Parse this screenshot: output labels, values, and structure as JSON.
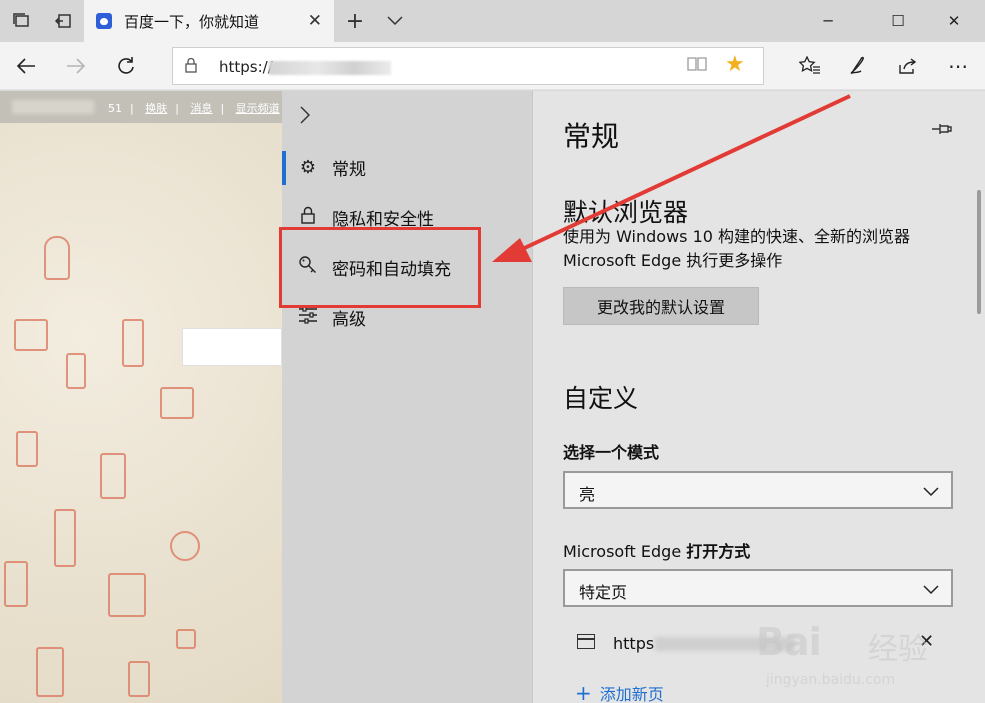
{
  "browser": {
    "tab": {
      "title": "百度一下，你就知道",
      "favicon": "baidu-paw-icon"
    },
    "new_tab_icon": "plus-icon",
    "tab_list_icon": "chevron-down-icon",
    "window_controls": {
      "minimize": "─",
      "maximize": "☐",
      "close": "✕"
    },
    "address": {
      "url_prefix": "https://",
      "lock_icon": "lock-icon"
    }
  },
  "page": {
    "topbar": {
      "count": "51",
      "links": [
        "换肤",
        "消息",
        "显示频道"
      ]
    }
  },
  "settings": {
    "nav": {
      "expand_icon": "chevron-right-icon",
      "items": [
        {
          "label": "常规",
          "icon": "gear-icon",
          "active": true
        },
        {
          "label": "隐私和安全性",
          "icon": "lock-icon",
          "active": false
        },
        {
          "label": "密码和自动填充",
          "icon": "key-icon",
          "active": false
        },
        {
          "label": "高级",
          "icon": "sliders-icon",
          "active": false
        }
      ]
    },
    "main": {
      "title": "常规",
      "pin_icon": "pin-icon",
      "default_browser": {
        "heading": "默认浏览器",
        "desc_line1": "使用为 Windows 10 构建的快速、全新的浏览器",
        "desc_line2": "Microsoft Edge 执行更多操作",
        "button": "更改我的默认设置"
      },
      "customize": {
        "heading": "自定义",
        "mode_label": "选择一个模式",
        "mode_value": "亮",
        "open_label_prefix": "Microsoft Edge",
        "open_label_suffix": "打开方式",
        "open_value": "特定页",
        "page_url": "https",
        "add_page": "添加新页"
      }
    }
  },
  "watermark": {
    "logo": "Bai",
    "logo_cn": "经验",
    "sub": "jingyan.baidu.com"
  },
  "colors": {
    "accent": "#1f6fd1",
    "highlight": "#e23b35",
    "star": "#f2b01e"
  }
}
